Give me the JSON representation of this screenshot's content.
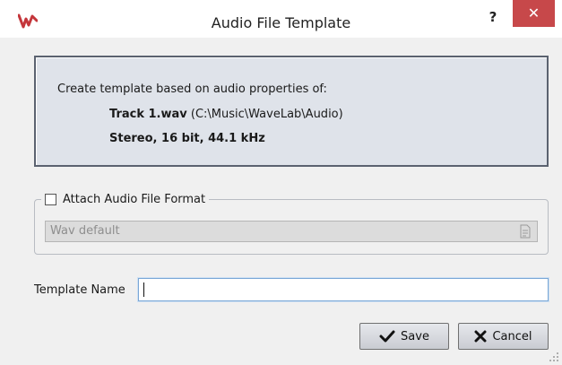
{
  "window": {
    "title": "Audio File Template",
    "help_label": "?",
    "close_label": "✕",
    "logo_icon": "wavelab-logo-icon",
    "accent_color": "#c7484a"
  },
  "info": {
    "intro": "Create template based on audio properties of:",
    "file_name": "Track 1.wav",
    "file_path": " (C:\\Music\\WaveLab\\Audio)",
    "properties": "Stereo, 16 bit, 44.1 kHz"
  },
  "format_group": {
    "checkbox_label": "Attach Audio File Format",
    "checked": false,
    "format_value": "Wav default",
    "preset_icon": "preset-document-icon"
  },
  "template_name": {
    "label": "Template Name",
    "value": ""
  },
  "buttons": {
    "save_label": "Save",
    "save_icon": "checkmark-icon",
    "cancel_label": "Cancel",
    "cancel_icon": "x-icon"
  }
}
